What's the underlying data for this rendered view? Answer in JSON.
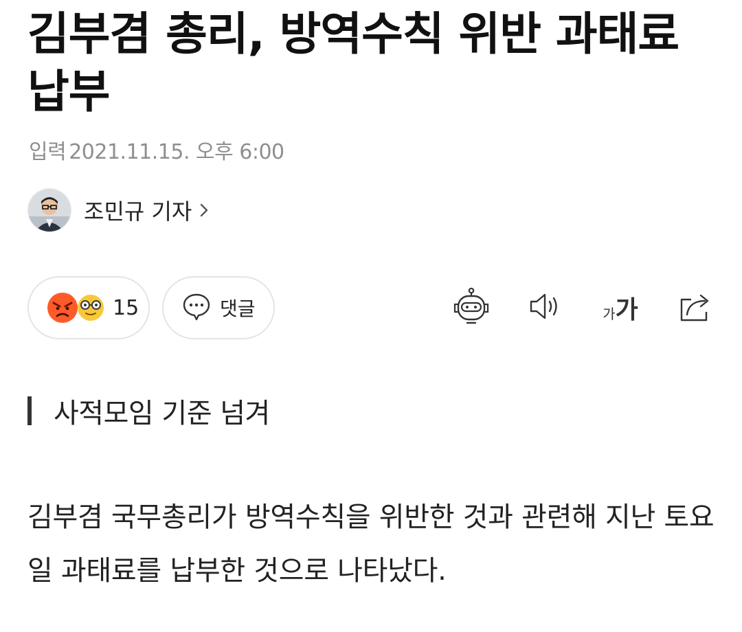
{
  "article": {
    "headline": "김부겸 총리, 방역수칙 위반 과태료 납부",
    "date_label": "입력",
    "date_value": "2021.11.15. 오후 6:00",
    "reporter": {
      "name": "조민규 기자",
      "chevron_icon": "chevron-right-icon"
    },
    "reactions": {
      "count": "15",
      "icons": [
        "angry-face-icon",
        "glasses-face-icon"
      ]
    },
    "comment_button": {
      "label": "댓글",
      "icon": "speech-bubble-icon"
    },
    "tools": {
      "summary_bot_icon": "robot-icon",
      "tts_icon": "speaker-icon",
      "font_size_small": "가",
      "font_size_large": "가",
      "share_icon": "share-icon"
    },
    "subheading": "사적모임 기준 넘겨",
    "body_text": "김부겸 국무총리가 방역수칙을 위반한 것과 관련해 지난 토요일 과태료를 납부한 것으로 나타났다."
  },
  "colors": {
    "text": "#111111",
    "meta_text": "#8e8e8e",
    "pill_border": "#e4e4e4",
    "angry_emoji": "#ff5a2a",
    "glasses_emoji": "#f9c83a"
  }
}
